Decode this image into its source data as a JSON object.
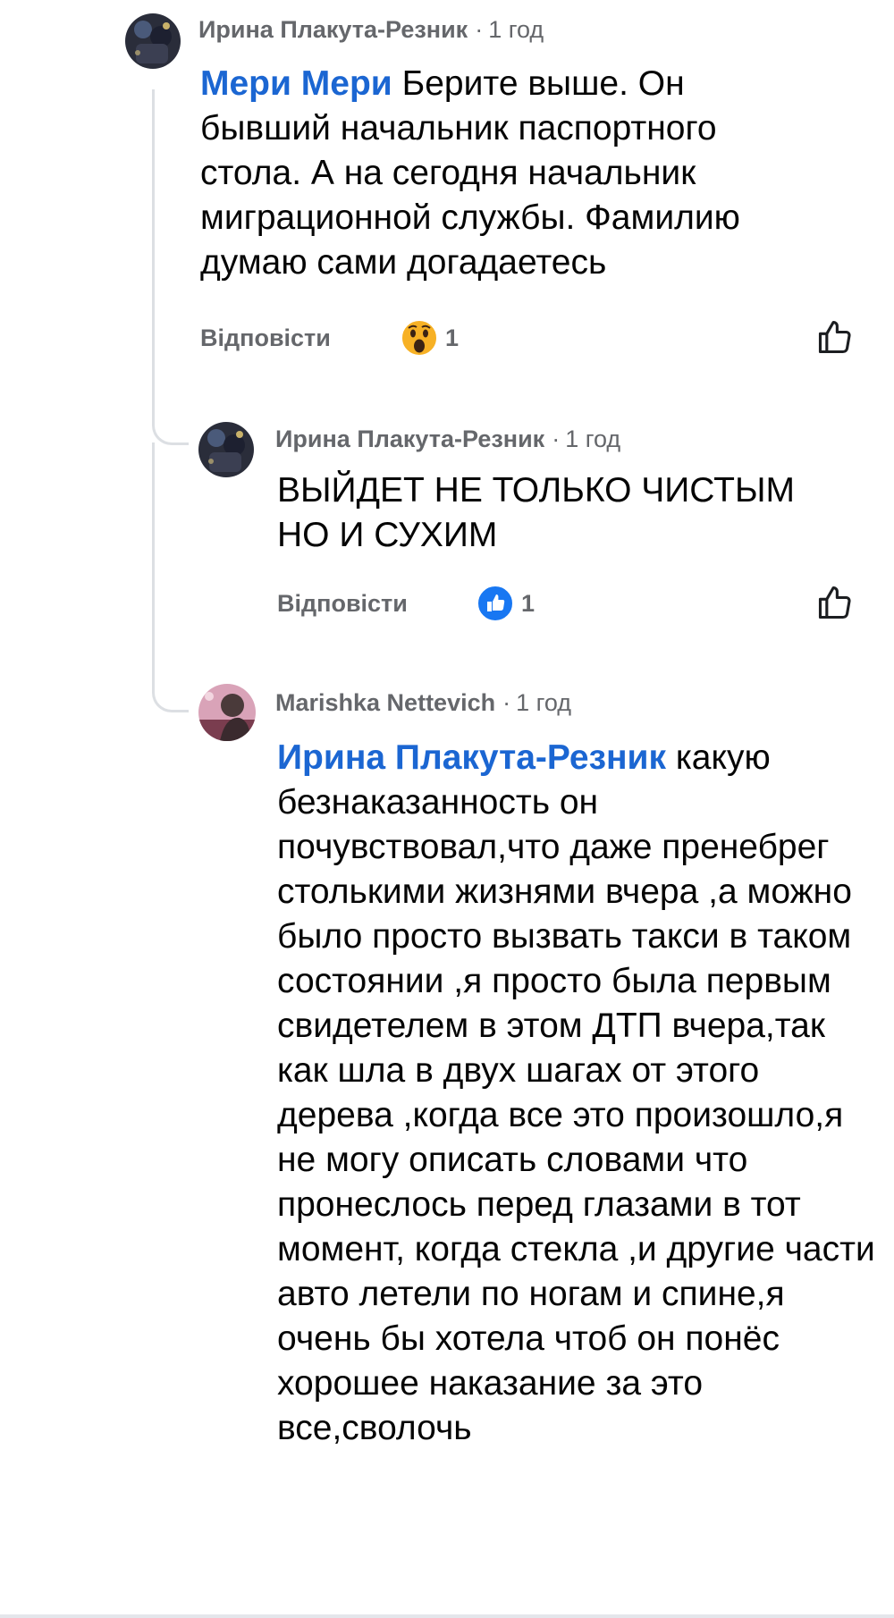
{
  "comments": [
    {
      "author": "Ирина Плакута-Резник",
      "time": "1 год",
      "mention": "Мери Мери",
      "text": " Берите выше. Он бывший начальник паспортного стола. А на сегодня начальник миграционной службы. Фамилию думаю сами догадаетесь",
      "reply_label": "Відповісти",
      "reaction": {
        "type": "wow",
        "count": "1"
      },
      "avatar_icon": "profile-photo-dark"
    },
    {
      "author": "Ирина Плакута-Резник",
      "time": "1 год",
      "mention": "",
      "text": "ВЫЙДЕТ НЕ ТОЛЬКО ЧИСТЫМ НО И СУХИМ",
      "reply_label": "Відповісти",
      "reaction": {
        "type": "like",
        "count": "1"
      },
      "avatar_icon": "profile-photo-dark"
    },
    {
      "author": "Marishka Nettevich",
      "time": "1 год",
      "mention": "Ирина Плакута-Резник",
      "text": " какую безнаказанность он почувствовал,что даже пренебрег столькими жизнями вчера ,а можно было просто вызвать такси в таком состоянии ,я просто была первым свидетелем в этом ДТП вчера,так как шла в двух шагах от этого дерева ,когда все это произошло,я не могу описать словами что пронеслось перед глазами в тот момент, когда стекла ,и другие части авто летели по ногам и спине,я очень бы хотела чтоб он понёс хорошее наказание за это все,сволочь",
      "avatar_icon": "profile-photo-pink"
    }
  ],
  "separator": "·",
  "colors": {
    "mention": "#1b66d2",
    "meta": "#65676b",
    "text": "#050505",
    "thread_line": "#dcdfe3",
    "like_blue": "#1877f2",
    "wow_yellow": "#f7b125"
  },
  "icons": {
    "like_outline": "thumbs-up-outline-icon",
    "wow": "wow-reaction-icon",
    "like": "like-reaction-icon"
  }
}
